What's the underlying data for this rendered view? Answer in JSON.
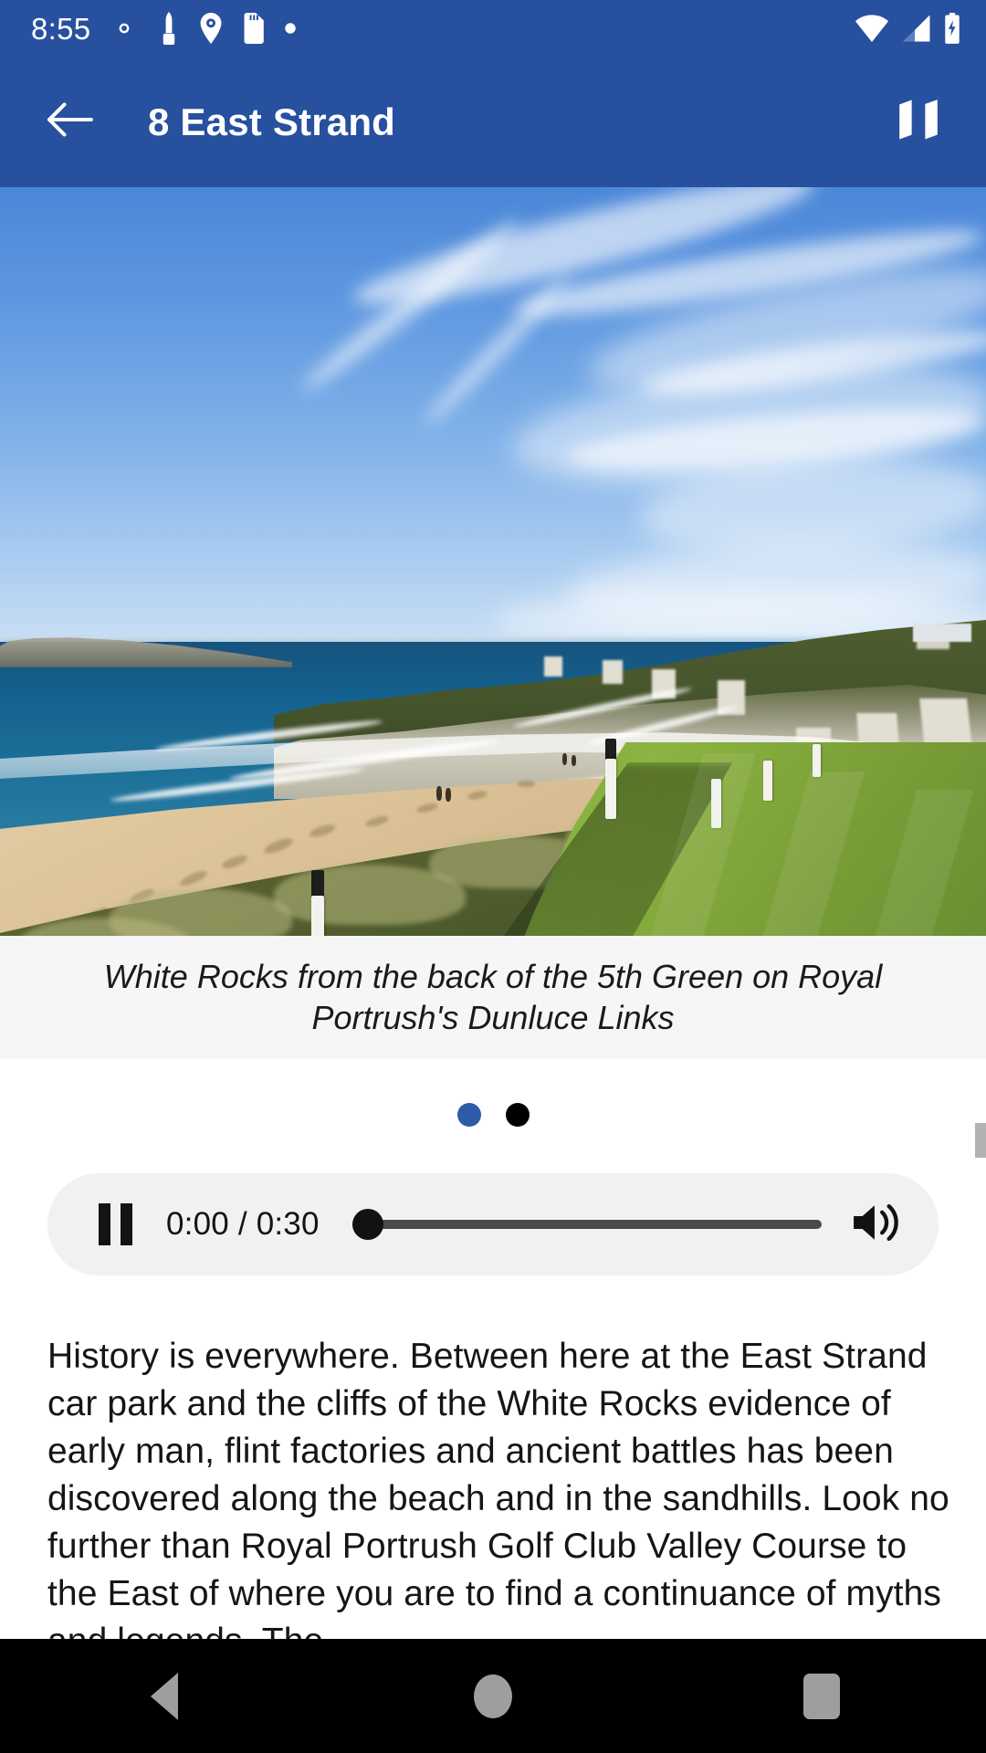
{
  "status_bar": {
    "time": "8:55",
    "left_icons": [
      "gear-icon",
      "monument-icon",
      "location-pin-icon",
      "sd-card-icon",
      "small-dot-icon"
    ],
    "right_icons": [
      "wifi-icon",
      "cellular-signal-icon",
      "battery-charging-icon"
    ],
    "background_color": "#27509E"
  },
  "app_bar": {
    "back_label": "back-arrow",
    "title": "8 East Strand",
    "map_label": "map",
    "background_color": "#27509E",
    "text_color": "#FFFFFF"
  },
  "photo": {
    "alt": "White Rocks coastline seen from the back of the 5th Green at Royal Portrush Dunluce Links",
    "caption": "White Rocks from the back of the 5th Green on Royal Portrush's Dunluce Links"
  },
  "pager": {
    "total": 2,
    "active_index": 0,
    "active_color": "#2D5BA8",
    "inactive_color": "#000000"
  },
  "audio_player": {
    "state": "playing",
    "pause_label": "pause",
    "time_display": "0:00 / 0:30",
    "current_time": "0:00",
    "duration": "0:30",
    "progress_percent": 0,
    "volume_label": "volume",
    "background_color": "#F1F1F1"
  },
  "article": {
    "body": "History is everywhere. Between here at the East Strand car park and the cliffs of the White Rocks evidence of early man, flint factories and ancient battles has been discovered along the beach and in the sandhills. Look no further than Royal Portrush Golf Club Valley Course to the East of where you are to find a continuance of myths and legends. The"
  },
  "scrollbar": {
    "position_label": "scroll-thumb"
  },
  "nav_bar": {
    "back_label": "back",
    "home_label": "home",
    "recents_label": "recent-apps",
    "background_color": "#000000",
    "icon_color": "#9E9E9E"
  }
}
